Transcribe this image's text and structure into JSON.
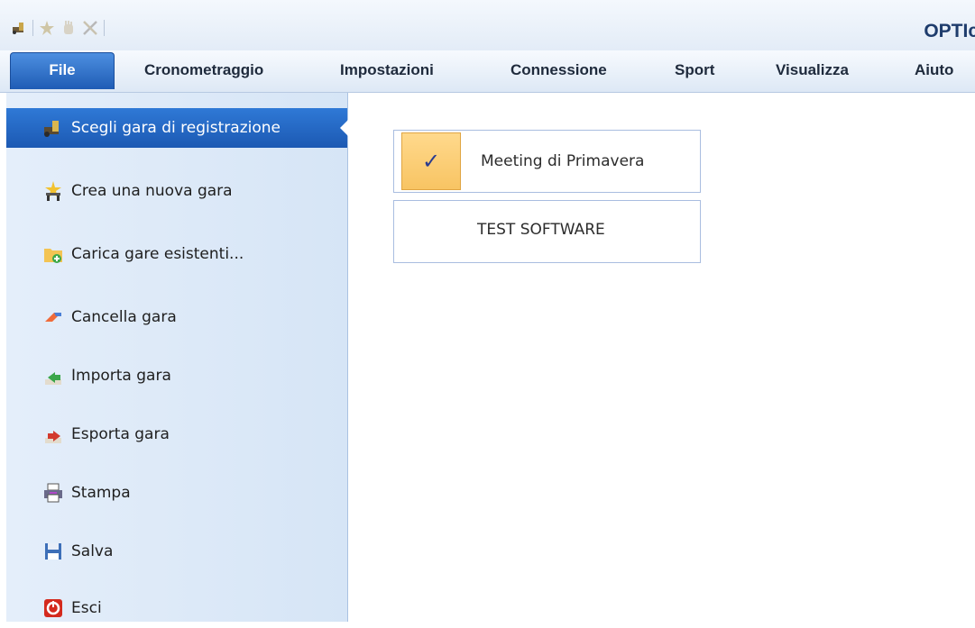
{
  "app": {
    "title": "OPTIc",
    "quick_access_icons": [
      "race-icon",
      "new-race-icon",
      "hand-icon",
      "tools-icon"
    ]
  },
  "menubar": {
    "items": [
      {
        "label": "File",
        "active": true
      },
      {
        "label": "Cronometraggio"
      },
      {
        "label": "Impostazioni"
      },
      {
        "label": "Connessione"
      },
      {
        "label": "Sport"
      },
      {
        "label": "Visualizza"
      },
      {
        "label": "Aiuto"
      }
    ]
  },
  "sidebar": {
    "items": [
      {
        "label": "Scegli gara di registrazione",
        "icon": "race-icon",
        "active": true
      },
      {
        "label": "Crea una nuova gara",
        "icon": "new-race-icon"
      },
      {
        "label": "Carica gare esistenti...",
        "icon": "folder-add-icon"
      },
      {
        "label": "Cancella gara",
        "icon": "eraser-icon"
      },
      {
        "label": "Importa gara",
        "icon": "import-icon"
      },
      {
        "label": "Esporta gara",
        "icon": "export-icon"
      },
      {
        "label": "Stampa",
        "icon": "printer-icon"
      },
      {
        "label": "Salva",
        "icon": "save-icon"
      },
      {
        "label": "Esci",
        "icon": "exit-icon"
      }
    ]
  },
  "races": [
    {
      "name": "Meeting di Primavera",
      "selected": true,
      "check_glyph": "✓"
    },
    {
      "name": "TEST SOFTWARE",
      "selected": false
    }
  ],
  "colors": {
    "accent": "#1f5cb5",
    "selection_orange": "#f8c463",
    "panel_bg": "#dce9f8"
  }
}
